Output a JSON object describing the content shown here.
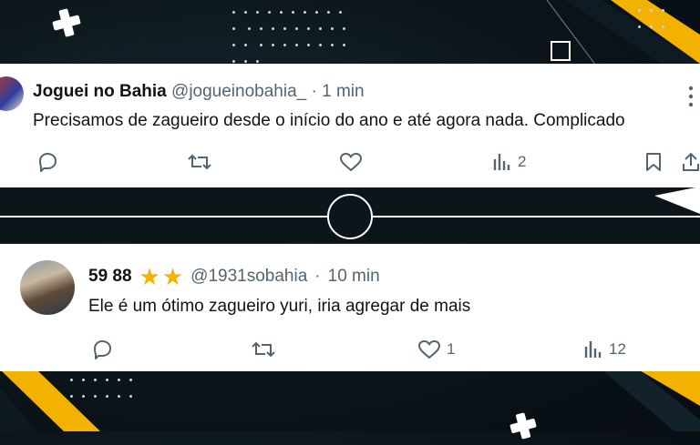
{
  "tweets": [
    {
      "name": "Joguei no Bahia",
      "handle": "@jogueinobahia_",
      "separator": "·",
      "time": "1 min",
      "text": "Precisamos de zagueiro desde o início do ano e até agora nada. Complicado",
      "views": "2"
    },
    {
      "name": "59 88",
      "handle": "@1931sobahia",
      "separator": "·",
      "time": "10 min",
      "text": "Ele é um ótimo zagueiro yuri, iria agregar de mais",
      "likes": "1",
      "views": "12"
    }
  ],
  "colors": {
    "accent": "#f4b200",
    "text": "#0f1419",
    "muted": "#536471"
  }
}
